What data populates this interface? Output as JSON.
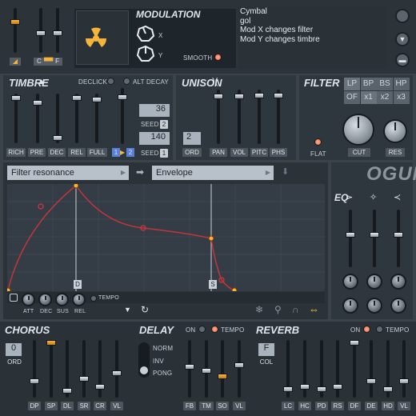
{
  "modulation": {
    "title": "MODULATION",
    "x_label": "X",
    "y_label": "Y",
    "smooth_label": "SMOOTH"
  },
  "notes": {
    "lines": [
      "Cymbal",
      "gol",
      "Mod X changes filter",
      "Mod Y changes timbre"
    ]
  },
  "top_left": {
    "label_c": "C",
    "label_f": "F"
  },
  "timbre": {
    "title": "TIMBRE",
    "declick": "DECLICK",
    "alt_decay": "ALT DECAY",
    "seed_val1": "36",
    "seed_label1": "SEED",
    "seed_num1": "2",
    "seed_val2": "140",
    "seed_label2": "SEED",
    "seed_num2": "1",
    "sliders": [
      "RICH",
      "PRE",
      "DEC",
      "REL",
      "FULL"
    ],
    "sel1": "1",
    "sel2": "2"
  },
  "unison": {
    "title": "UNISON",
    "ord_value": "2",
    "ord_label": "ORD",
    "sliders": [
      "PAN",
      "VOL",
      "PITC",
      "PHS"
    ]
  },
  "filter": {
    "title": "FILTER",
    "types": [
      "LP",
      "BP",
      "BS",
      "HP",
      "OF",
      "x1",
      "x2",
      "x3"
    ],
    "flat": "FLAT",
    "cut": "CUT",
    "res": "RES"
  },
  "envelope": {
    "target": "Filter resonance",
    "source": "Envelope",
    "knobs": [
      "ATT",
      "DEC",
      "SUS",
      "REL"
    ],
    "tempo": "TEMPO",
    "marker_d": "D",
    "marker_s": "S"
  },
  "logo": "OGUN",
  "eq": {
    "title": "EQ"
  },
  "chorus": {
    "title": "CHORUS",
    "ord_value": "0",
    "ord_label": "ORD",
    "sliders": [
      "DP",
      "SP",
      "DL",
      "SR",
      "CR",
      "VL"
    ]
  },
  "delay": {
    "title": "DELAY",
    "on": "ON",
    "tempo": "TEMPO",
    "modes": [
      "NORM",
      "INV",
      "PONG"
    ],
    "sliders": [
      "FB",
      "TM",
      "SO",
      "VL"
    ]
  },
  "reverb": {
    "title": "REVERB",
    "on": "ON",
    "tempo": "TEMPO",
    "col_value": "F",
    "col_label": "COL",
    "sliders": [
      "LC",
      "HC",
      "PD",
      "RS",
      "DF",
      "DE",
      "HD",
      "VL"
    ]
  },
  "colors": {
    "accent": "#f6b53a",
    "led": "#f25a2e",
    "curve": "#c2353c"
  }
}
